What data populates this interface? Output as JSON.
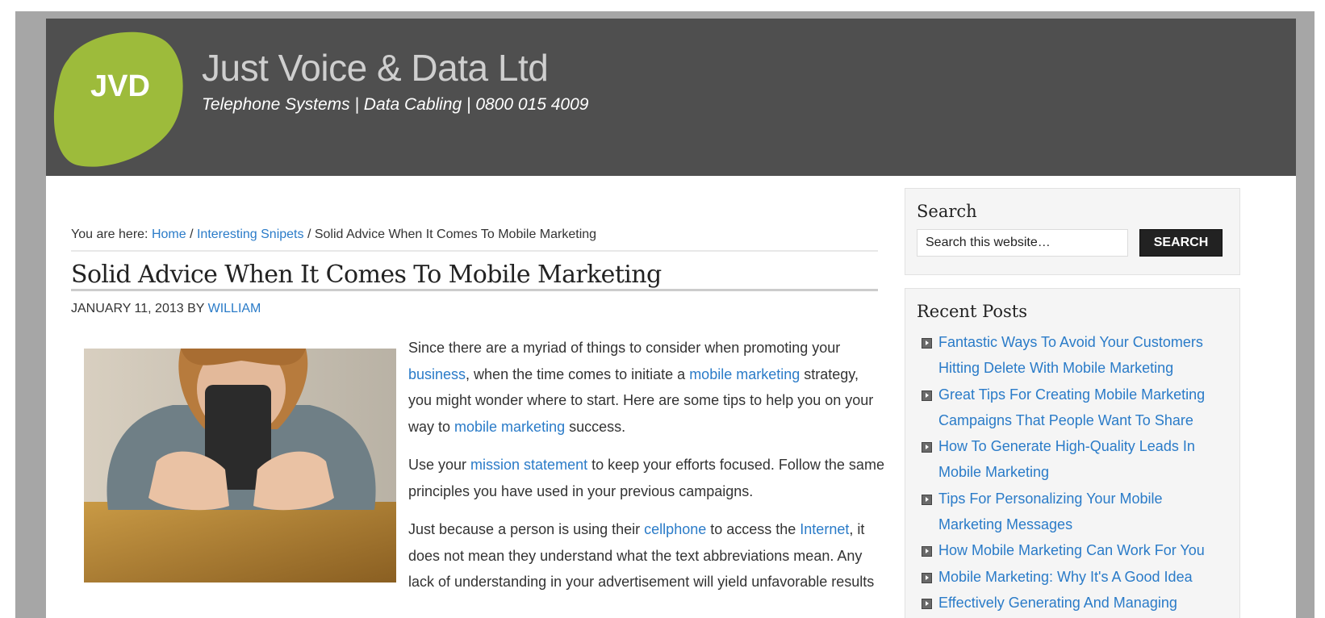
{
  "header": {
    "logo_text": "JVD",
    "site_title": "Just Voice & Data Ltd",
    "site_description": "Telephone Systems | Data Cabling | 0800 015 4009"
  },
  "breadcrumb": {
    "prefix": "You are here: ",
    "home": "Home",
    "sep1": " / ",
    "category": "Interesting Snipets",
    "sep2": " / ",
    "current": "Solid Advice When It Comes To Mobile Marketing"
  },
  "post": {
    "title": "Solid Advice When It Comes To Mobile Marketing",
    "date": "January 11, 2013",
    "by": " by ",
    "author": "William",
    "image_alt": "Person looking at a mobile phone",
    "p1": {
      "t1": "Since there are a myriad of things to consider when promoting your ",
      "link1": "business",
      "t2": ", when the time comes to initiate a ",
      "link2": "mobile marketing",
      "t3": " strategy, you might wonder where to start. Here are some tips to help you on your way to ",
      "link3": "mobile marketing",
      "t4": " success."
    },
    "p2": {
      "t1": "Use your ",
      "link1": "mission statement",
      "t2": " to keep your efforts focused. Follow the same principles you have used in your previous campaigns."
    },
    "p3": {
      "t1": "Just because a person is using their ",
      "link1": "cellphone",
      "t2": " to access the ",
      "link2": "Internet",
      "t3": ", it does not mean they understand what the text abbreviations mean. Any lack of understanding in your advertisement will yield unfavorable results"
    }
  },
  "sidebar": {
    "search": {
      "title": "Search",
      "placeholder": "Search this website…",
      "button": "SEARCH"
    },
    "recent": {
      "title": "Recent Posts",
      "items": [
        "Fantastic Ways To Avoid Your Customers Hitting Delete With Mobile Marketing",
        "Great Tips For Creating Mobile Marketing Campaigns That People Want To Share",
        "How To Generate High-Quality Leads In Mobile Marketing",
        "Tips For Personalizing Your Mobile Marketing Messages",
        "How Mobile Marketing Can Work For You",
        "Mobile Marketing: Why It's A Good Idea",
        "Effectively Generating And Managing"
      ]
    }
  },
  "colors": {
    "header_bg": "#4f4f4f",
    "logo_green": "#9dbb3b",
    "link": "#2a7bc8",
    "frame": "#a6a6a6"
  }
}
